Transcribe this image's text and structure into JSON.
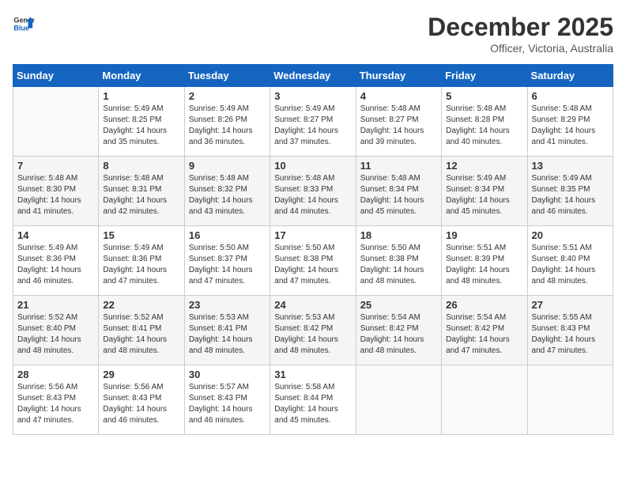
{
  "header": {
    "logo_line1": "General",
    "logo_line2": "Blue",
    "month": "December 2025",
    "location": "Officer, Victoria, Australia"
  },
  "days_of_week": [
    "Sunday",
    "Monday",
    "Tuesday",
    "Wednesday",
    "Thursday",
    "Friday",
    "Saturday"
  ],
  "weeks": [
    [
      {
        "day": "",
        "info": ""
      },
      {
        "day": "1",
        "info": "Sunrise: 5:49 AM\nSunset: 8:25 PM\nDaylight: 14 hours\nand 35 minutes."
      },
      {
        "day": "2",
        "info": "Sunrise: 5:49 AM\nSunset: 8:26 PM\nDaylight: 14 hours\nand 36 minutes."
      },
      {
        "day": "3",
        "info": "Sunrise: 5:49 AM\nSunset: 8:27 PM\nDaylight: 14 hours\nand 37 minutes."
      },
      {
        "day": "4",
        "info": "Sunrise: 5:48 AM\nSunset: 8:27 PM\nDaylight: 14 hours\nand 39 minutes."
      },
      {
        "day": "5",
        "info": "Sunrise: 5:48 AM\nSunset: 8:28 PM\nDaylight: 14 hours\nand 40 minutes."
      },
      {
        "day": "6",
        "info": "Sunrise: 5:48 AM\nSunset: 8:29 PM\nDaylight: 14 hours\nand 41 minutes."
      }
    ],
    [
      {
        "day": "7",
        "info": "Sunrise: 5:48 AM\nSunset: 8:30 PM\nDaylight: 14 hours\nand 41 minutes."
      },
      {
        "day": "8",
        "info": "Sunrise: 5:48 AM\nSunset: 8:31 PM\nDaylight: 14 hours\nand 42 minutes."
      },
      {
        "day": "9",
        "info": "Sunrise: 5:48 AM\nSunset: 8:32 PM\nDaylight: 14 hours\nand 43 minutes."
      },
      {
        "day": "10",
        "info": "Sunrise: 5:48 AM\nSunset: 8:33 PM\nDaylight: 14 hours\nand 44 minutes."
      },
      {
        "day": "11",
        "info": "Sunrise: 5:48 AM\nSunset: 8:34 PM\nDaylight: 14 hours\nand 45 minutes."
      },
      {
        "day": "12",
        "info": "Sunrise: 5:49 AM\nSunset: 8:34 PM\nDaylight: 14 hours\nand 45 minutes."
      },
      {
        "day": "13",
        "info": "Sunrise: 5:49 AM\nSunset: 8:35 PM\nDaylight: 14 hours\nand 46 minutes."
      }
    ],
    [
      {
        "day": "14",
        "info": "Sunrise: 5:49 AM\nSunset: 8:36 PM\nDaylight: 14 hours\nand 46 minutes."
      },
      {
        "day": "15",
        "info": "Sunrise: 5:49 AM\nSunset: 8:36 PM\nDaylight: 14 hours\nand 47 minutes."
      },
      {
        "day": "16",
        "info": "Sunrise: 5:50 AM\nSunset: 8:37 PM\nDaylight: 14 hours\nand 47 minutes."
      },
      {
        "day": "17",
        "info": "Sunrise: 5:50 AM\nSunset: 8:38 PM\nDaylight: 14 hours\nand 47 minutes."
      },
      {
        "day": "18",
        "info": "Sunrise: 5:50 AM\nSunset: 8:38 PM\nDaylight: 14 hours\nand 48 minutes."
      },
      {
        "day": "19",
        "info": "Sunrise: 5:51 AM\nSunset: 8:39 PM\nDaylight: 14 hours\nand 48 minutes."
      },
      {
        "day": "20",
        "info": "Sunrise: 5:51 AM\nSunset: 8:40 PM\nDaylight: 14 hours\nand 48 minutes."
      }
    ],
    [
      {
        "day": "21",
        "info": "Sunrise: 5:52 AM\nSunset: 8:40 PM\nDaylight: 14 hours\nand 48 minutes."
      },
      {
        "day": "22",
        "info": "Sunrise: 5:52 AM\nSunset: 8:41 PM\nDaylight: 14 hours\nand 48 minutes."
      },
      {
        "day": "23",
        "info": "Sunrise: 5:53 AM\nSunset: 8:41 PM\nDaylight: 14 hours\nand 48 minutes."
      },
      {
        "day": "24",
        "info": "Sunrise: 5:53 AM\nSunset: 8:42 PM\nDaylight: 14 hours\nand 48 minutes."
      },
      {
        "day": "25",
        "info": "Sunrise: 5:54 AM\nSunset: 8:42 PM\nDaylight: 14 hours\nand 48 minutes."
      },
      {
        "day": "26",
        "info": "Sunrise: 5:54 AM\nSunset: 8:42 PM\nDaylight: 14 hours\nand 47 minutes."
      },
      {
        "day": "27",
        "info": "Sunrise: 5:55 AM\nSunset: 8:43 PM\nDaylight: 14 hours\nand 47 minutes."
      }
    ],
    [
      {
        "day": "28",
        "info": "Sunrise: 5:56 AM\nSunset: 8:43 PM\nDaylight: 14 hours\nand 47 minutes."
      },
      {
        "day": "29",
        "info": "Sunrise: 5:56 AM\nSunset: 8:43 PM\nDaylight: 14 hours\nand 46 minutes."
      },
      {
        "day": "30",
        "info": "Sunrise: 5:57 AM\nSunset: 8:43 PM\nDaylight: 14 hours\nand 46 minutes."
      },
      {
        "day": "31",
        "info": "Sunrise: 5:58 AM\nSunset: 8:44 PM\nDaylight: 14 hours\nand 45 minutes."
      },
      {
        "day": "",
        "info": ""
      },
      {
        "day": "",
        "info": ""
      },
      {
        "day": "",
        "info": ""
      }
    ]
  ]
}
